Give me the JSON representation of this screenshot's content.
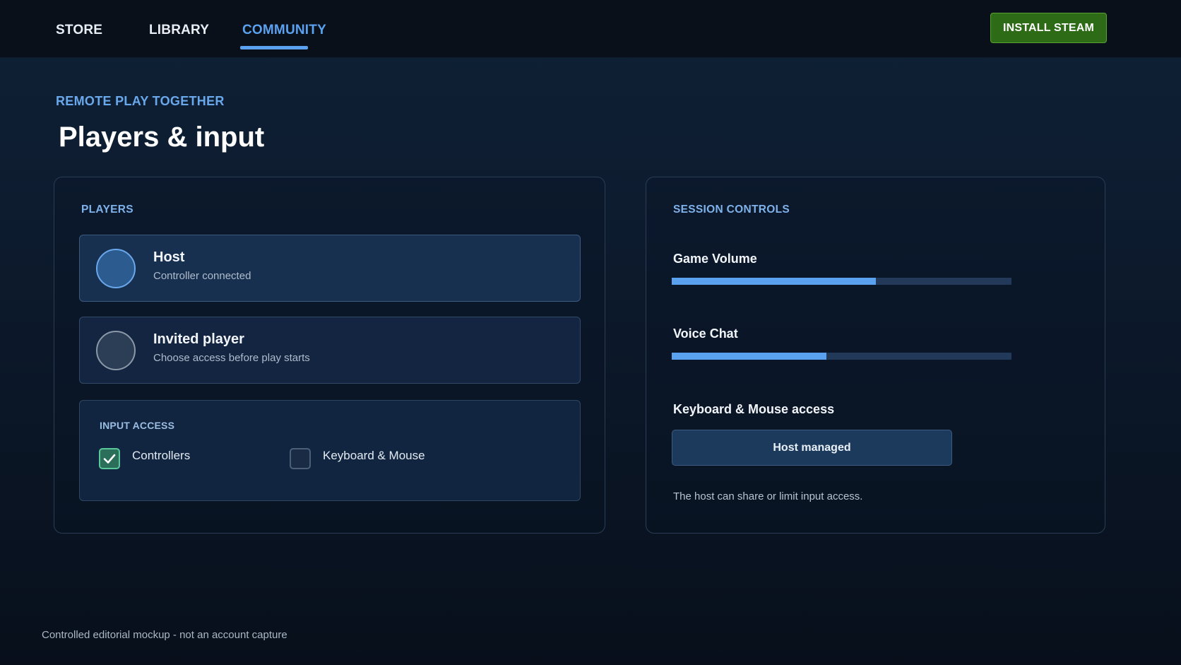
{
  "nav": {
    "items": [
      {
        "label": "STORE",
        "active": false
      },
      {
        "label": "LIBRARY",
        "active": false
      },
      {
        "label": "COMMUNITY",
        "active": true
      }
    ],
    "install_label": "INSTALL STEAM"
  },
  "header": {
    "eyebrow": "REMOTE PLAY TOGETHER",
    "title": "Players & input"
  },
  "players_card": {
    "label": "PLAYERS",
    "players": [
      {
        "name": "Host",
        "status": "Controller connected"
      },
      {
        "name": "Invited player",
        "status": "Choose access before play starts"
      }
    ],
    "input_access": {
      "label": "INPUT ACCESS",
      "options": [
        {
          "label": "Controllers",
          "checked": true
        },
        {
          "label": "Keyboard & Mouse",
          "checked": false
        }
      ]
    }
  },
  "session_card": {
    "label": "SESSION CONTROLS",
    "game_volume": {
      "label": "Game Volume",
      "level": 0.6
    },
    "voice_chat": {
      "label": "Voice Chat",
      "level": 0.455
    },
    "kbm_access": {
      "label": "Keyboard & Mouse access",
      "button_label": "Host managed",
      "note": "The host can share or limit input access."
    }
  },
  "footer": {
    "note": "Controlled editorial mockup - not an account capture"
  },
  "colors": {
    "accent": "#5aa2f0",
    "install_green": "#2e6b16",
    "check_green": "#59c79a"
  }
}
